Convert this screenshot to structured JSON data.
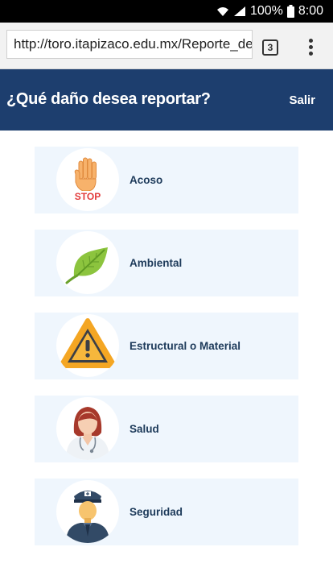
{
  "status_bar": {
    "battery_percent": "100%",
    "time": "8:00"
  },
  "browser": {
    "url": "http://toro.itapizaco.edu.mx/Reporte_de",
    "tab_count": "3"
  },
  "header": {
    "title": "¿Qué daño desea reportar?",
    "logout_label": "Salir",
    "background_color": "#1d3e6e"
  },
  "categories": [
    {
      "label": "Acoso",
      "icon": "stop-hand-icon"
    },
    {
      "label": "Ambiental",
      "icon": "leaf-icon"
    },
    {
      "label": "Estructural o Material",
      "icon": "warning-triangle-icon"
    },
    {
      "label": "Salud",
      "icon": "doctor-icon"
    },
    {
      "label": "Seguridad",
      "icon": "security-guard-icon"
    }
  ]
}
